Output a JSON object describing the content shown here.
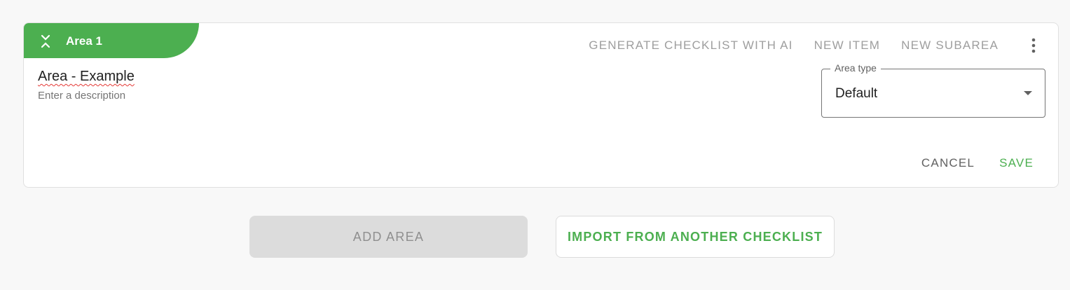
{
  "area": {
    "tab_label": "Area 1",
    "name": "Area - Example",
    "description_placeholder": "Enter a description",
    "type_field": {
      "label": "Area type",
      "value": "Default"
    }
  },
  "toolbar": {
    "generate_ai_label": "GENERATE CHECKLIST WITH AI",
    "new_item_label": "NEW ITEM",
    "new_subarea_label": "NEW SUBAREA",
    "more_icon": "more-vertical-icon"
  },
  "form_actions": {
    "cancel_label": "CANCEL",
    "save_label": "SAVE"
  },
  "footer": {
    "add_area_label": "ADD AREA",
    "import_label": "IMPORT FROM ANOTHER CHECKLIST"
  },
  "colors": {
    "accent": "#4caf50",
    "disabled_bg": "#dcdcdc",
    "muted_text": "#9e9e9e"
  }
}
